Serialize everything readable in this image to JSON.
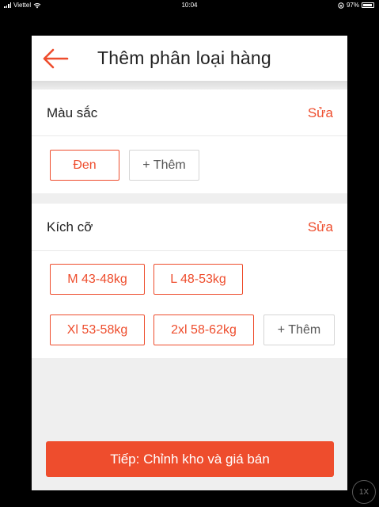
{
  "status_bar": {
    "carrier": "Viettel",
    "time": "10:04",
    "battery": "97%"
  },
  "header": {
    "title": "Thêm phân loại hàng"
  },
  "colors": "#ee4d2d",
  "sections": {
    "color": {
      "title": "Màu sắc",
      "edit_label": "Sửa",
      "values": [
        "Đen"
      ],
      "add_label": "+ Thêm"
    },
    "size": {
      "title": "Kích cỡ",
      "edit_label": "Sửa",
      "values": [
        "M 43-48kg",
        "L 48-53kg",
        "Xl 53-58kg",
        "2xl 58-62kg"
      ],
      "add_label": "+ Thêm"
    }
  },
  "footer": {
    "next_label": "Tiếp: Chỉnh kho và giá bán"
  },
  "zoom_badge": "1X"
}
